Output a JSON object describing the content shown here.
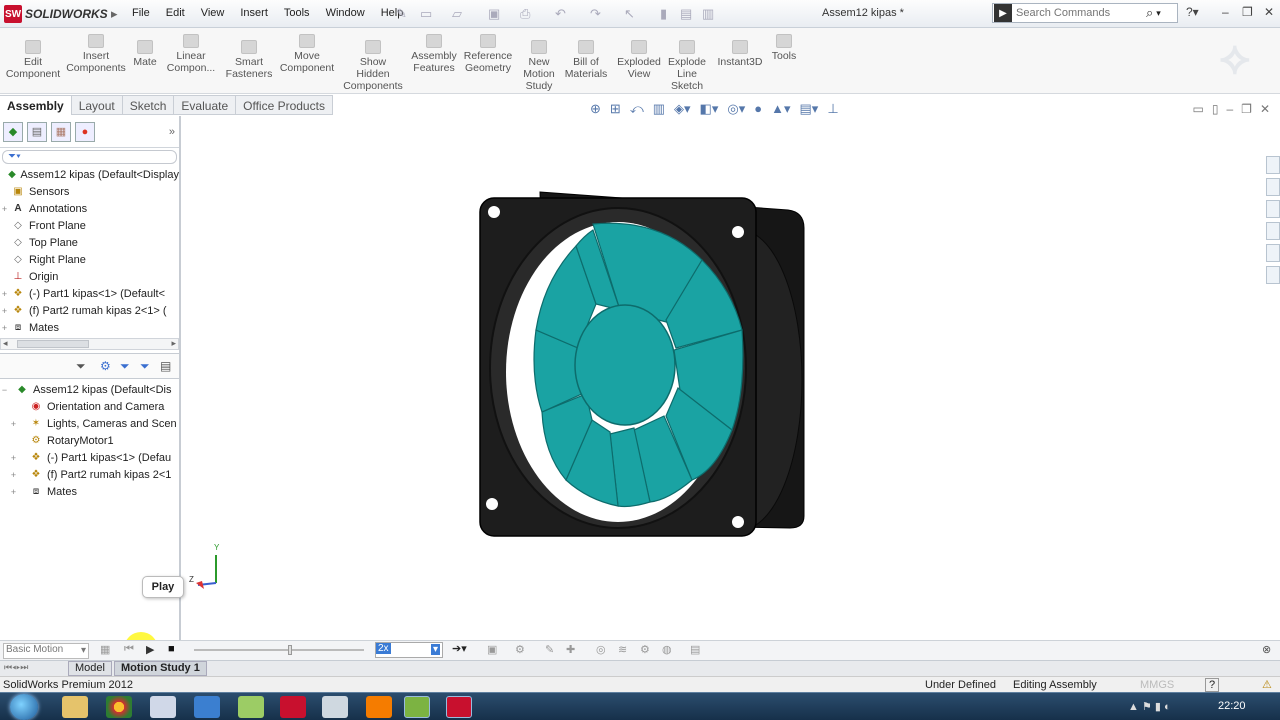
{
  "app": {
    "logo_mark": "SW",
    "logo_text": "SOLIDWORKS",
    "document_title": "Assem12 kipas *"
  },
  "menu": [
    "File",
    "Edit",
    "View",
    "Insert",
    "Tools",
    "Window",
    "Help"
  ],
  "search": {
    "placeholder": "Search Commands"
  },
  "ribbon": [
    {
      "label": "Edit Component"
    },
    {
      "label": "Insert Components"
    },
    {
      "label": "Mate"
    },
    {
      "label": "Linear Compon..."
    },
    {
      "label": "Smart Fasteners"
    },
    {
      "label": "Move Component"
    },
    {
      "label": "Show Hidden Components"
    },
    {
      "label": "Assembly Features"
    },
    {
      "label": "Reference Geometry"
    },
    {
      "label": "New Motion Study"
    },
    {
      "label": "Bill of Materials"
    },
    {
      "label": "Exploded View"
    },
    {
      "label": "Explode Line Sketch"
    },
    {
      "label": "Instant3D"
    },
    {
      "label": "Tools"
    }
  ],
  "tabs": [
    "Assembly",
    "Layout",
    "Sketch",
    "Evaluate",
    "Office Products"
  ],
  "feature_tree": [
    {
      "label": "Assem12 kipas  (Default<Display",
      "icon": "assembly-icon",
      "expander": ""
    },
    {
      "label": "Sensors",
      "icon": "sensor-icon",
      "expander": ""
    },
    {
      "label": "Annotations",
      "icon": "annotation-icon",
      "expander": "+"
    },
    {
      "label": "Front Plane",
      "icon": "plane-icon",
      "expander": ""
    },
    {
      "label": "Top Plane",
      "icon": "plane-icon",
      "expander": ""
    },
    {
      "label": "Right Plane",
      "icon": "plane-icon",
      "expander": ""
    },
    {
      "label": "Origin",
      "icon": "origin-icon",
      "expander": ""
    },
    {
      "label": "(-) Part1 kipas<1> (Default<",
      "icon": "part-icon",
      "expander": "+"
    },
    {
      "label": "(f) Part2 rumah kipas 2<1> (",
      "icon": "part-icon",
      "expander": "+"
    },
    {
      "label": "Mates",
      "icon": "mates-icon",
      "expander": "+"
    }
  ],
  "motion_tree": [
    {
      "label": "Assem12 kipas  (Default<Dis",
      "icon": "assembly-icon",
      "expander": "−"
    },
    {
      "label": "Orientation and Camera",
      "icon": "camera-icon",
      "expander": ""
    },
    {
      "label": "Lights, Cameras and Scen",
      "icon": "lights-icon",
      "expander": "+"
    },
    {
      "label": "RotaryMotor1",
      "icon": "motor-icon",
      "expander": ""
    },
    {
      "label": "(-) Part1 kipas<1> (Defau",
      "icon": "part-icon",
      "expander": "+"
    },
    {
      "label": "(f) Part2 rumah kipas 2<1",
      "icon": "part-icon",
      "expander": "+"
    },
    {
      "label": "Mates",
      "icon": "mates-icon",
      "expander": "+"
    }
  ],
  "tooltip": "Play",
  "motion": {
    "study_type": "Basic Motion",
    "speed": "2x",
    "playback_position": 0.56
  },
  "bottom_tabs": [
    "Model",
    "Motion Study 1"
  ],
  "status": {
    "product": "SolidWorks Premium 2012",
    "state": "Under Defined",
    "mode": "Editing Assembly",
    "units": "MMGS",
    "help": "?"
  },
  "taskbar": {
    "clock": "22:20"
  },
  "axis": {
    "y": "Y",
    "z": "Z"
  },
  "colors": {
    "accent": "#3a7bd5",
    "fan_blade": "#1aa3a3",
    "fan_frame": "#1f1f1f",
    "brand_red": "#c8102e"
  }
}
